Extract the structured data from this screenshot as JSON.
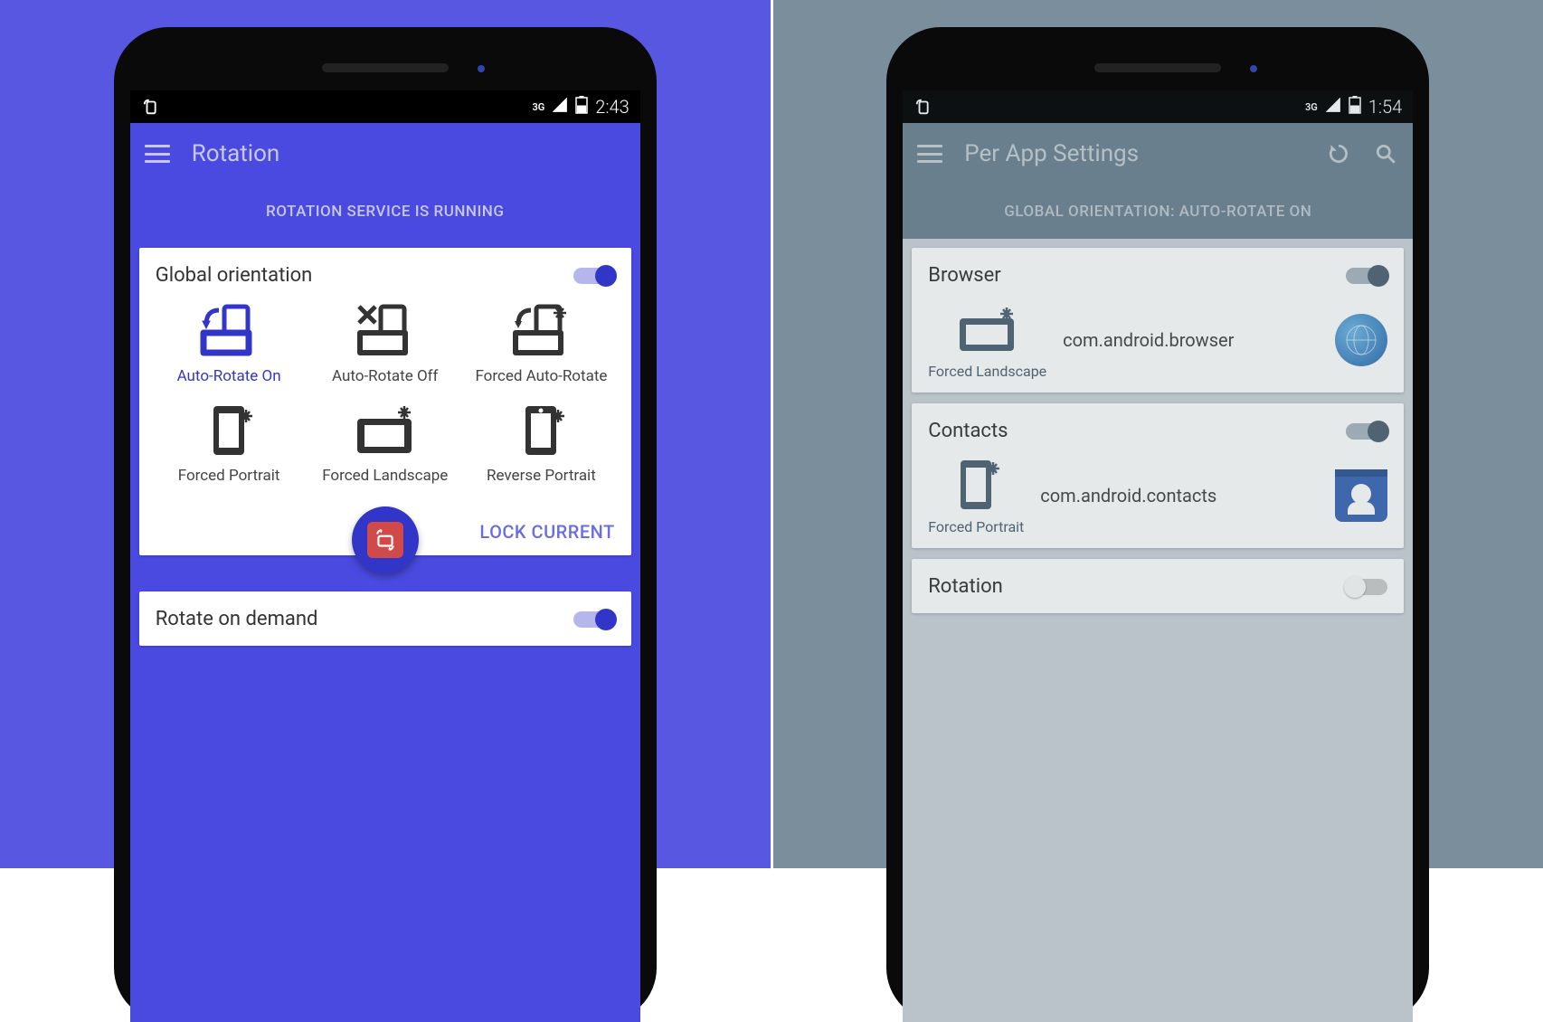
{
  "left": {
    "status": {
      "time": "2:43",
      "network_label": "3G"
    },
    "appbar": {
      "title": "Rotation"
    },
    "banner": "ROTATION SERVICE IS RUNNING",
    "card1": {
      "title": "Global orientation",
      "toggle_on": true,
      "items": [
        {
          "label": "Auto-Rotate On",
          "selected": true
        },
        {
          "label": "Auto-Rotate Off",
          "selected": false
        },
        {
          "label": "Forced Auto-Rotate",
          "selected": false
        },
        {
          "label": "Forced Portrait",
          "selected": false
        },
        {
          "label": "Forced Landscape",
          "selected": false
        },
        {
          "label": "Reverse Portrait",
          "selected": false
        }
      ],
      "lock_label": "LOCK CURRENT"
    },
    "card2": {
      "title": "Rotate on demand",
      "toggle_on": true
    }
  },
  "right": {
    "status": {
      "time": "1:54",
      "network_label": "3G"
    },
    "appbar": {
      "title": "Per App Settings"
    },
    "banner": "GLOBAL ORIENTATION: AUTO-ROTATE ON",
    "apps": [
      {
        "name": "Browser",
        "toggle_on": true,
        "orientation": "Forced Landscape",
        "package": "com.android.browser",
        "icon": "browser"
      },
      {
        "name": "Contacts",
        "toggle_on": true,
        "orientation": "Forced Portrait",
        "package": "com.android.contacts",
        "icon": "contacts"
      },
      {
        "name": "Rotation",
        "toggle_on": false,
        "orientation": "",
        "package": "",
        "icon": ""
      }
    ]
  },
  "colors": {
    "accent_blue": "#3236c8",
    "accent_slate": "#4e6274"
  }
}
